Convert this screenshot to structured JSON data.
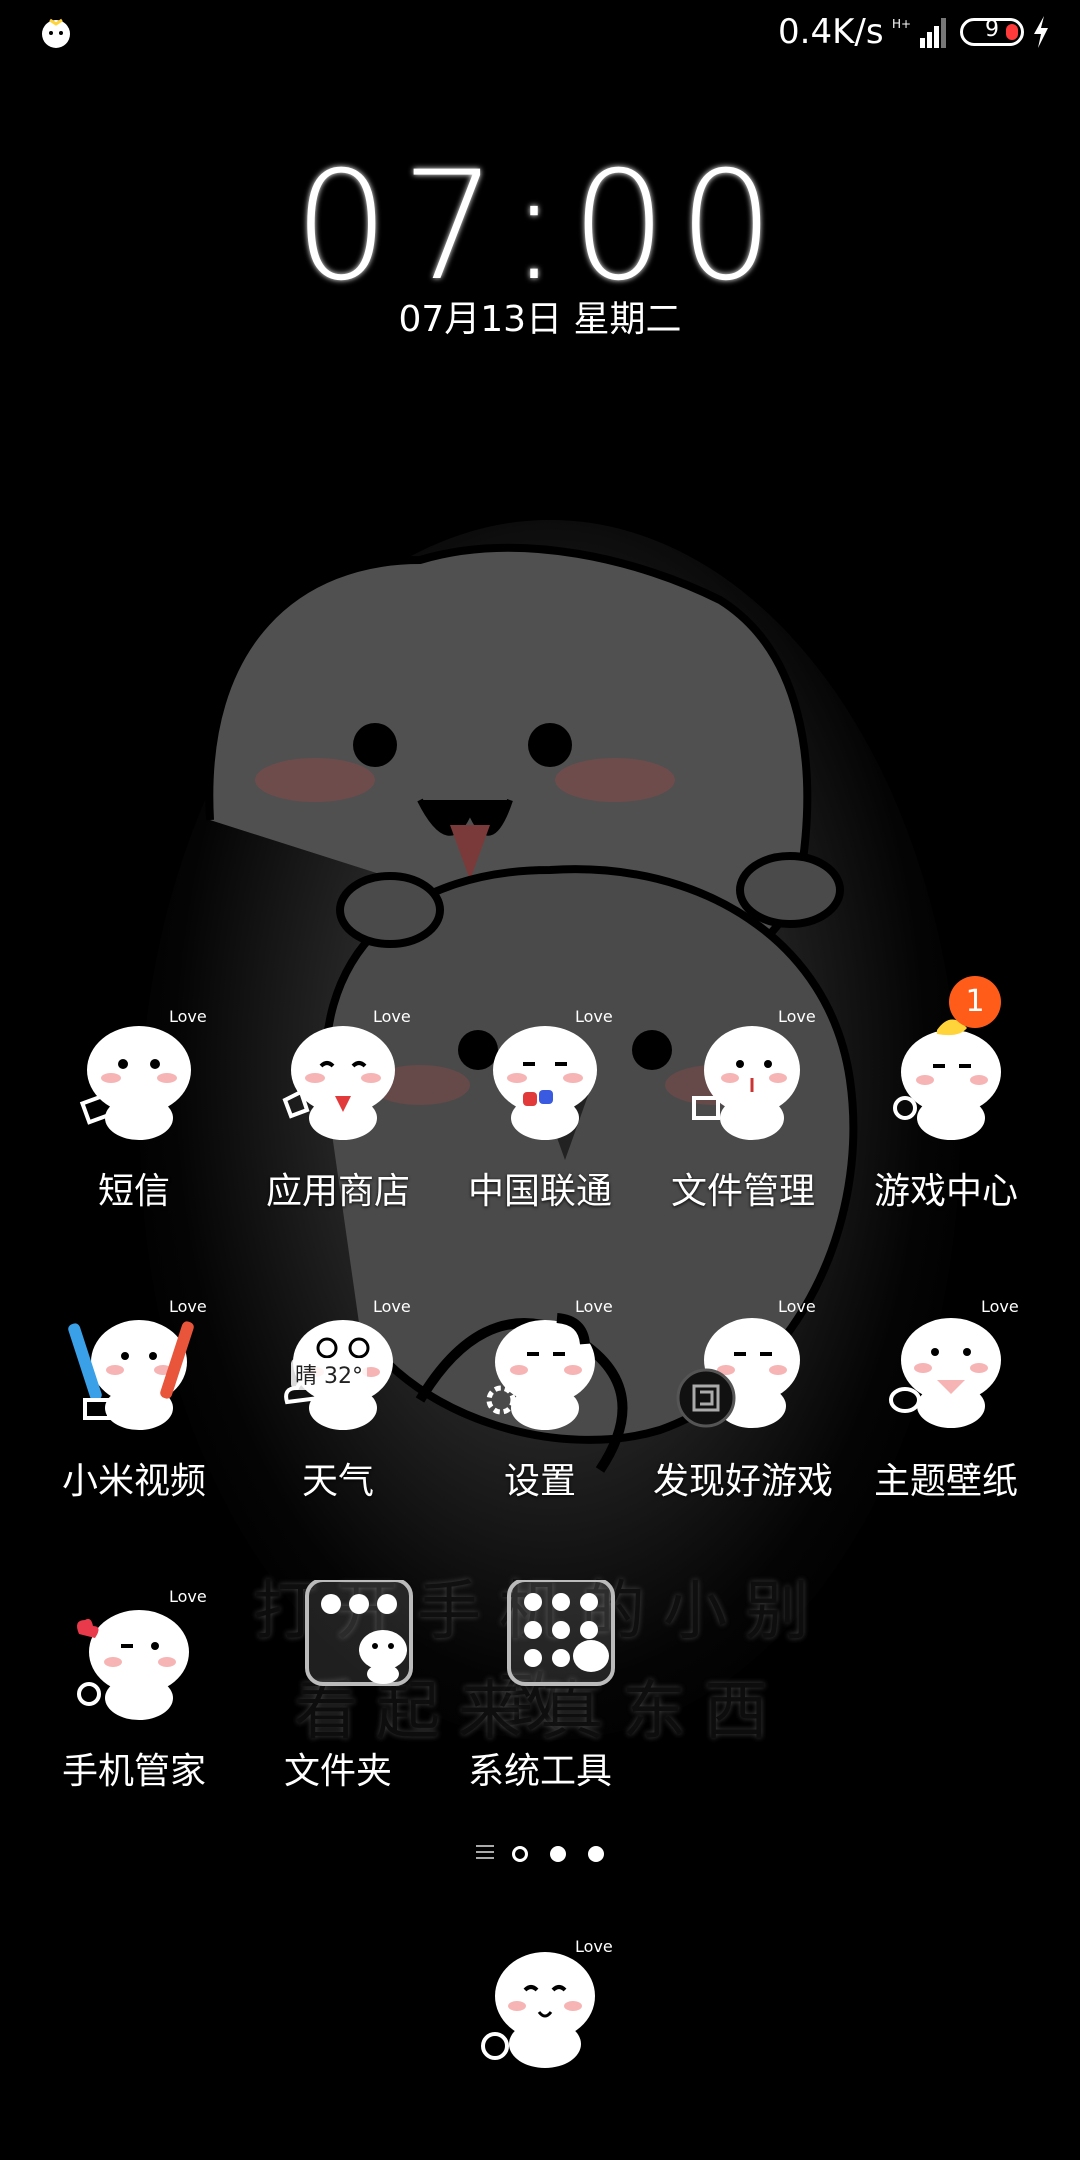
{
  "status_bar": {
    "speed": "0.4K/s",
    "network": "H+",
    "battery_level": "9",
    "battery_low_color": "#ff3a3a"
  },
  "clock": {
    "time": "07:00",
    "date": "07月13日 星期二"
  },
  "wallpaper": {
    "line1": "打开手机的小别致",
    "line2": "看起来真东西"
  },
  "apps": {
    "row1": [
      {
        "label": "短信",
        "icon": "messages-icon"
      },
      {
        "label": "应用商店",
        "icon": "app-store-icon"
      },
      {
        "label": "中国联通",
        "icon": "china-unicom-icon"
      },
      {
        "label": "文件管理",
        "icon": "file-manager-icon"
      },
      {
        "label": "游戏中心",
        "icon": "game-center-icon",
        "badge": "1"
      }
    ],
    "row2": [
      {
        "label": "小米视频",
        "icon": "mi-video-icon"
      },
      {
        "label": "天气",
        "icon": "weather-icon",
        "weather": "晴 32°"
      },
      {
        "label": "设置",
        "icon": "settings-icon"
      },
      {
        "label": "发现好游戏",
        "icon": "discover-games-icon"
      },
      {
        "label": "主题壁纸",
        "icon": "themes-icon"
      }
    ],
    "row3": [
      {
        "label": "手机管家",
        "icon": "security-icon"
      },
      {
        "label": "文件夹",
        "icon": "folder-icon"
      },
      {
        "label": "系统工具",
        "icon": "system-tools-icon"
      }
    ]
  },
  "badge_color": "#ff5c1a",
  "pages": {
    "count": 3,
    "current": 1
  }
}
